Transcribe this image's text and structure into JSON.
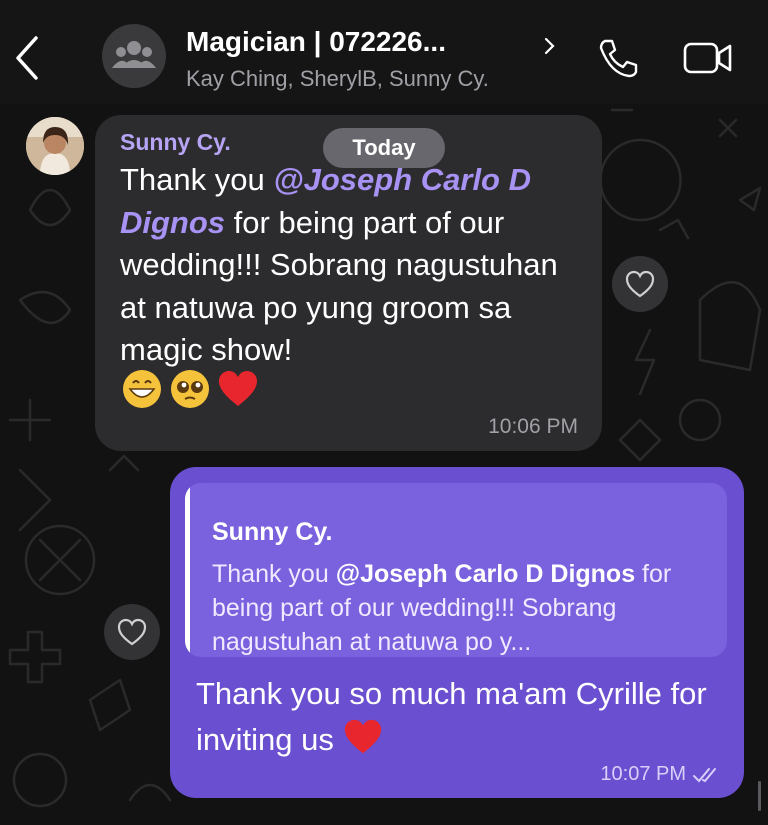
{
  "header": {
    "title": "Magician | 072226...",
    "members": "Kay Ching, SherylB, Sunny Cy."
  },
  "date_divider": "Today",
  "messages": [
    {
      "sender": "Sunny Cy.",
      "text_before": "Thank you ",
      "mention": "@Joseph Carlo D Dignos",
      "text_after": " for being part of our wedding!!! Sobrang nagustuhan at natuwa po yung groom sa magic show!",
      "emojis": [
        "grinning-face",
        "pleading-face",
        "red-heart"
      ],
      "time": "10:06 PM"
    },
    {
      "quote": {
        "sender": "Sunny Cy.",
        "text_before": "Thank you ",
        "mention": "@Joseph Carlo D Dignos",
        "text_after": " for being part of our wedding!!! Sobrang nagustuhan at natuwa po y..."
      },
      "text": "Thank you so much ma'am Cyrille for inviting us",
      "emoji": "red-heart",
      "time": "10:07 PM",
      "status": "delivered"
    }
  ],
  "colors": {
    "background": "#121212",
    "incoming_bubble": "#2c2c2e",
    "outgoing_bubble": "#6a4fd0",
    "quote_bg": "#7a61de",
    "mention": "#a892f3",
    "sender_name": "#b7a4f5"
  },
  "icons": {
    "back": "chevron-left-icon",
    "group": "group-icon",
    "info": "chevron-right-icon",
    "call": "phone-icon",
    "video": "video-icon",
    "react": "heart-outline-icon",
    "status": "double-check-icon"
  }
}
